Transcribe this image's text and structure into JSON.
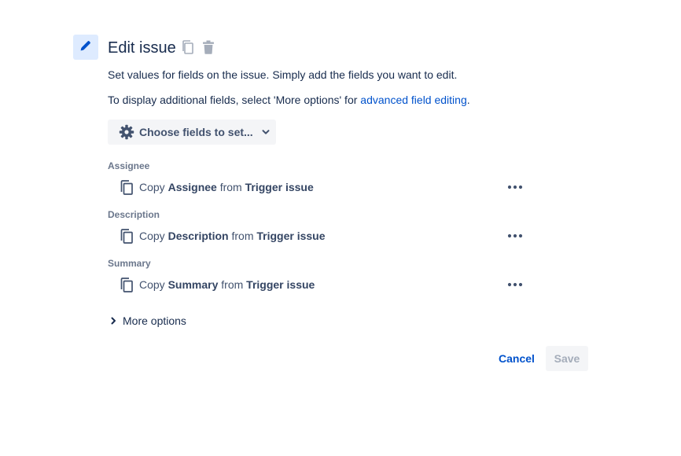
{
  "header": {
    "title": "Edit issue",
    "icon": "pencil-icon",
    "accent_bg": "#deebff",
    "accent": "#0052cc"
  },
  "description": {
    "line1": "Set values for fields on the issue. Simply add the fields you want to edit.",
    "line2_prefix": "To display additional fields, select 'More options' for ",
    "line2_link": "advanced field editing",
    "line2_suffix": "."
  },
  "choose_fields": {
    "label": "Choose fields to set..."
  },
  "fields": [
    {
      "label": "Assignee",
      "copy": "Copy",
      "field": "Assignee",
      "from": "from",
      "source": "Trigger issue"
    },
    {
      "label": "Description",
      "copy": "Copy",
      "field": "Description",
      "from": "from",
      "source": "Trigger issue"
    },
    {
      "label": "Summary",
      "copy": "Copy",
      "field": "Summary",
      "from": "from",
      "source": "Trigger issue"
    }
  ],
  "more_options": {
    "label": "More options"
  },
  "footer": {
    "cancel_label": "Cancel",
    "save_label": "Save"
  }
}
